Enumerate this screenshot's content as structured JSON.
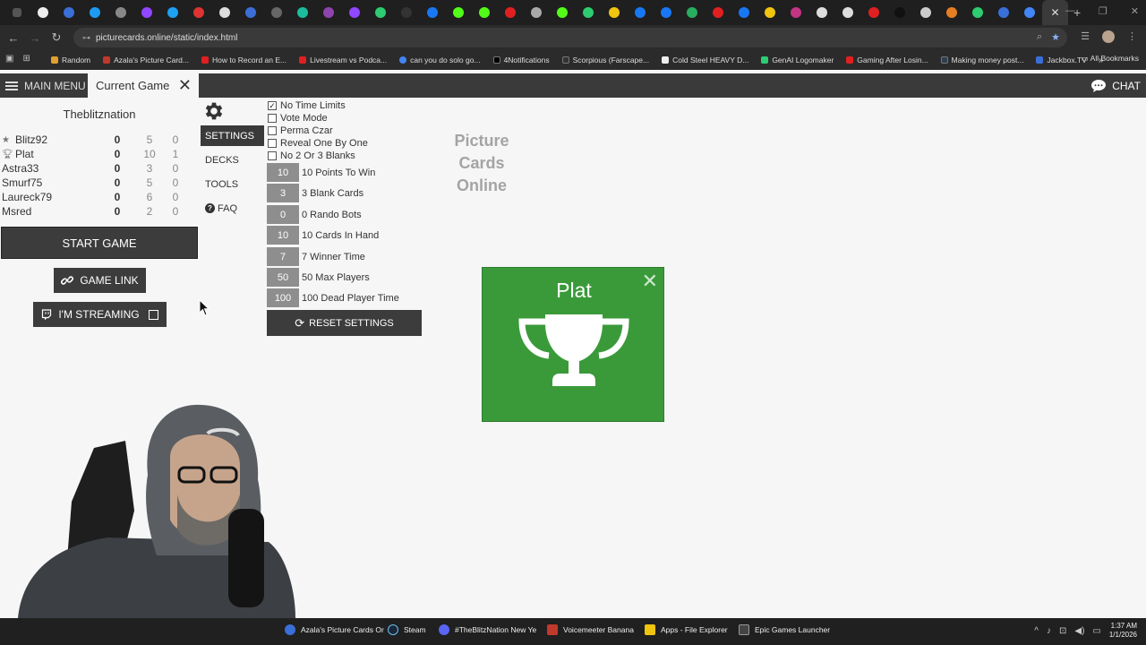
{
  "browser": {
    "url": "picturecards.online/static/index.html",
    "new_tab": "+",
    "bookmarks": [
      {
        "label": "Random",
        "color": "#e0a030"
      },
      {
        "label": "Azala's Picture Card...",
        "color": "#c0392b"
      },
      {
        "label": "How to Record an E...",
        "color": "#e02020"
      },
      {
        "label": "Livestream vs Podca...",
        "color": "#e02020"
      },
      {
        "label": "can you do solo go...",
        "color": "#4285f4"
      },
      {
        "label": "4Notifications",
        "color": "#000000"
      },
      {
        "label": "Scorpious (Farscape...",
        "color": "#333333"
      },
      {
        "label": "Cold Steel HEAVY D...",
        "color": "#eeeeee"
      },
      {
        "label": "GenAI Logomaker",
        "color": "#2ecc71"
      },
      {
        "label": "Gaming After Losin...",
        "color": "#e02020"
      },
      {
        "label": "Making money post...",
        "color": "#2c3e50"
      },
      {
        "label": "Jackbox.TV",
        "color": "#3a6fd8"
      }
    ],
    "all_bookmarks": "All Bookmarks"
  },
  "app": {
    "main_menu": "MAIN MENU",
    "current_tab": "Current Game",
    "chat": "CHAT"
  },
  "game": {
    "host": "Theblitznation",
    "players": [
      {
        "name": "Blitz92",
        "icon": "star-icon",
        "score": "0",
        "col2": "5",
        "col3": "0"
      },
      {
        "name": "Plat",
        "icon": "trophy-icon",
        "score": "0",
        "col2": "10",
        "col3": "1"
      },
      {
        "name": "Astra33",
        "icon": "",
        "score": "0",
        "col2": "3",
        "col3": "0"
      },
      {
        "name": "Smurf75",
        "icon": "",
        "score": "0",
        "col2": "5",
        "col3": "0"
      },
      {
        "name": "Laureck79",
        "icon": "",
        "score": "0",
        "col2": "6",
        "col3": "0"
      },
      {
        "name": "Msred",
        "icon": "",
        "score": "0",
        "col2": "2",
        "col3": "0"
      }
    ],
    "start_game": "START GAME",
    "game_link": "GAME LINK",
    "streaming": "I'M STREAMING"
  },
  "menu": {
    "settings": "SETTINGS",
    "decks": "DECKS",
    "tools": "TOOLS",
    "faq": "FAQ"
  },
  "settings": {
    "checkboxes": [
      {
        "label": "No Time Limits",
        "checked": true
      },
      {
        "label": "Vote Mode",
        "checked": false
      },
      {
        "label": "Perma Czar",
        "checked": false
      },
      {
        "label": "Reveal One By One",
        "checked": false
      },
      {
        "label": "No 2 Or 3 Blanks",
        "checked": false
      }
    ],
    "numbers": [
      {
        "value": "10",
        "label": "10 Points To Win"
      },
      {
        "value": "3",
        "label": "3 Blank Cards"
      },
      {
        "value": "0",
        "label": "0 Rando Bots"
      },
      {
        "value": "10",
        "label": "10 Cards In Hand"
      },
      {
        "value": "7",
        "label": "7 Winner Time"
      },
      {
        "value": "50",
        "label": "50 Max Players"
      },
      {
        "value": "100",
        "label": "100 Dead Player Time"
      }
    ],
    "reset": "RESET SETTINGS"
  },
  "logo": {
    "line1": "Picture",
    "line2": "Cards",
    "line3": "Online"
  },
  "winner": {
    "name": "Plat",
    "color": "#3a9a3a"
  },
  "taskbar": {
    "items": [
      {
        "label": "Azala's Picture Cards Or",
        "color": "#3a6fd8"
      },
      {
        "label": "Steam",
        "color": "#1b2838"
      },
      {
        "label": "#TheBlitzNation New Ye",
        "color": "#5865f2"
      },
      {
        "label": "Voicemeeter Banana",
        "color": "#c0392b"
      },
      {
        "label": "Apps - File Explorer",
        "color": "#f1c40f"
      },
      {
        "label": "Epic Games Launcher",
        "color": "#444444"
      }
    ],
    "time": "1:37 AM",
    "date": "1/1/2026"
  }
}
